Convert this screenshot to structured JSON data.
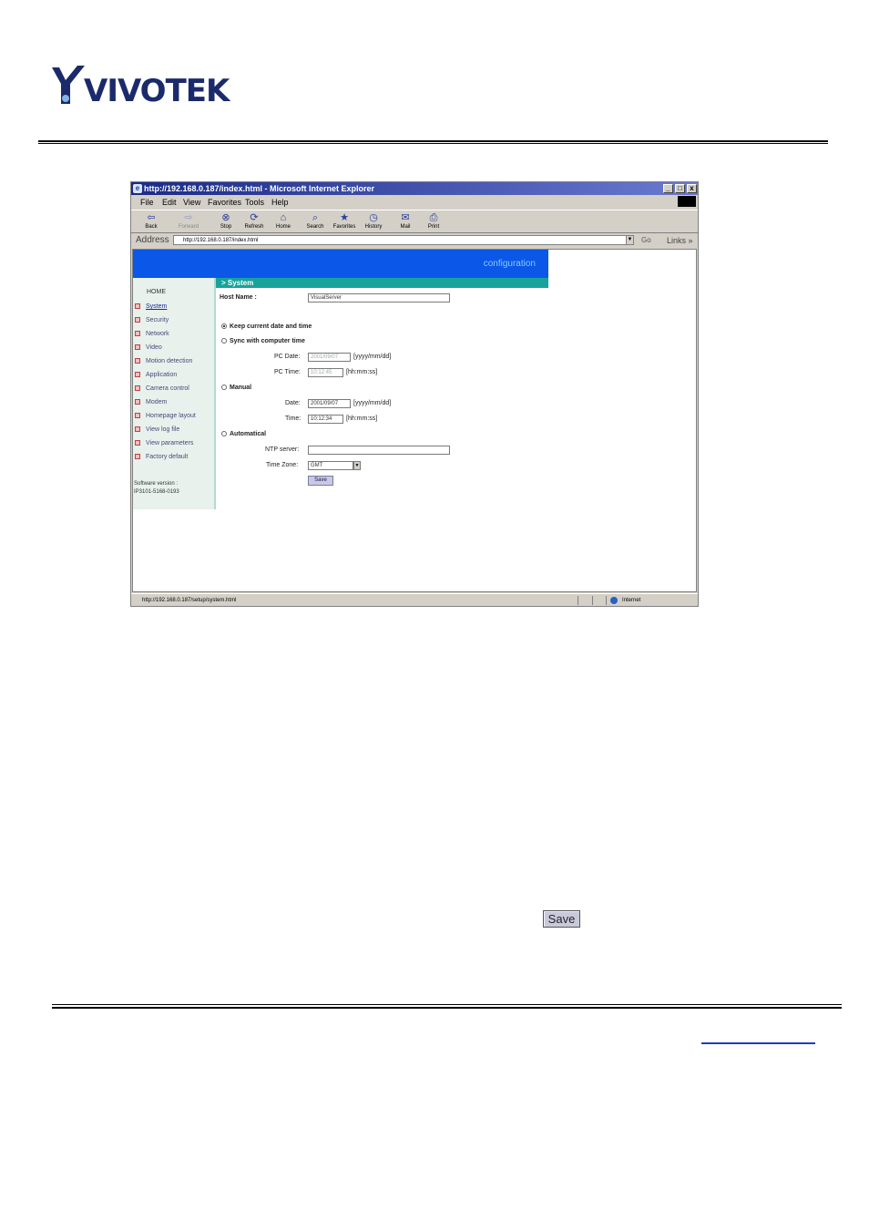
{
  "brand": {
    "logo_text": "VIVOTEK"
  },
  "window": {
    "title": "http://192.168.0.187/index.html - Microsoft Internet Explorer",
    "controls": [
      "_",
      "□",
      "x"
    ]
  },
  "menu": [
    "File",
    "Edit",
    "View",
    "Favorites",
    "Tools",
    "Help"
  ],
  "toolbar": [
    {
      "label": "Back",
      "icon": "back-arrow-icon",
      "glyph": "⇦",
      "enabled": true
    },
    {
      "label": "Forward",
      "icon": "forward-arrow-icon",
      "glyph": "⇨",
      "enabled": false
    },
    {
      "label": "Stop",
      "icon": "stop-icon",
      "glyph": "⊗",
      "enabled": true
    },
    {
      "label": "Refresh",
      "icon": "refresh-icon",
      "glyph": "⟳",
      "enabled": true
    },
    {
      "label": "Home",
      "icon": "home-icon",
      "glyph": "⌂",
      "enabled": true
    },
    {
      "label": "Search",
      "icon": "search-icon",
      "glyph": "⌕",
      "enabled": true
    },
    {
      "label": "Favorites",
      "icon": "favorites-icon",
      "glyph": "★",
      "enabled": true
    },
    {
      "label": "History",
      "icon": "history-icon",
      "glyph": "◷",
      "enabled": true
    },
    {
      "label": "Mail",
      "icon": "mail-icon",
      "glyph": "✉",
      "enabled": true
    },
    {
      "label": "Print",
      "icon": "print-icon",
      "glyph": "⎙",
      "enabled": true
    }
  ],
  "address": {
    "label": "Address",
    "url": "http://192.168.0.187/index.html",
    "go": "Go",
    "links": "Links »"
  },
  "page": {
    "banner": "configuration",
    "section_title": "> System",
    "sidebar": {
      "home": "HOME",
      "items": [
        "System",
        "Security",
        "Network",
        "Video",
        "Motion detection",
        "Application",
        "Camera control",
        "Modem",
        "Homepage layout",
        "View log file",
        "View parameters",
        "Factory default"
      ],
      "software_label": "Software version :",
      "software_version": "IP3101-5168-0193"
    },
    "form": {
      "host_name_label": "Host Name :",
      "host_name_value": "VisualServer",
      "opt_keep": "Keep current date and time",
      "opt_sync": "Sync with computer time",
      "pc_date_label": "PC Date:",
      "pc_date_value": "2001/09/07",
      "date_fmt": "[yyyy/mm/dd]",
      "pc_time_label": "PC Time:",
      "pc_time_value": "10:12:45",
      "time_fmt": "[hh:mm:ss]",
      "opt_manual": "Manual",
      "date_label": "Date:",
      "date_value": "2001/09/07",
      "time_label": "Time:",
      "time_value": "10:12:34",
      "opt_auto": "Automatical",
      "ntp_label": "NTP server:",
      "ntp_value": "",
      "tz_label": "Time Zone:",
      "tz_value": "GMT",
      "save": "Save"
    }
  },
  "status": {
    "text": "http://192.168.0.187/setup/system.html",
    "zone": "Internet"
  },
  "save_button": "Save"
}
